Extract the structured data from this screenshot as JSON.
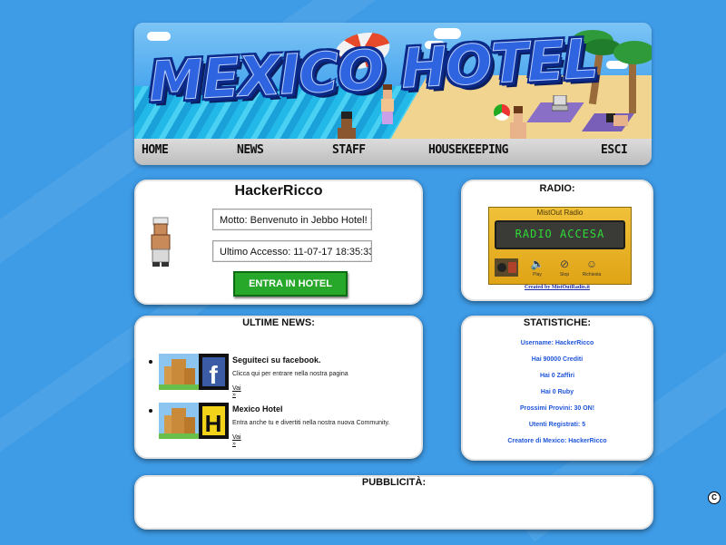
{
  "header": {
    "logo_text": "MEXICO HOTEL",
    "nav": [
      "HOME",
      "NEWS",
      "STAFF",
      "HOUSEKEEPING",
      "ESCI"
    ]
  },
  "user": {
    "name": "HackerRicco",
    "motto": "Motto: Benvenuto in Jebbo Hotel! ;D",
    "last_access": "Ultimo Accesso: 11-07-17 18:35:33",
    "enter_button": "ENTRA IN HOTEL"
  },
  "radio": {
    "title": "RADIO:",
    "brand": "MistOut Radio",
    "display": "RADIO ACCESA",
    "controls": [
      "Play",
      "Stop",
      "Richiesta"
    ],
    "credit": "Created by MistOutRadio.it"
  },
  "news": {
    "title": "ULTIME NEWS:",
    "items": [
      {
        "headline": "Seguiteci su facebook.",
        "body": "Clicca qui per entrare nella nostra pagina",
        "link": "Vai »",
        "badge": "f"
      },
      {
        "headline": "Mexico Hotel",
        "body": "Entra anche tu e divertiti nella nostra nuova Community.",
        "link": "Vai »",
        "badge": "H"
      }
    ]
  },
  "stats": {
    "title": "STATISTICHE:",
    "lines": [
      "Username: HackerRicco",
      "Hai 90000 Crediti",
      "Hai 0 Zaffiri",
      "Hai 0 Ruby",
      "Prossimi Provini: 30 ON!",
      "Utenti Registrati: 5",
      "Creatore di Mexico: HackerRicco"
    ]
  },
  "ads": {
    "title": "PUBBLICITÀ:"
  },
  "footer": {
    "copyright_symbol": "C"
  },
  "colors": {
    "background": "#3e9be6",
    "enter_button": "#27a82a",
    "stats_text": "#1f55d9",
    "radio_led": "#2fdc36"
  }
}
